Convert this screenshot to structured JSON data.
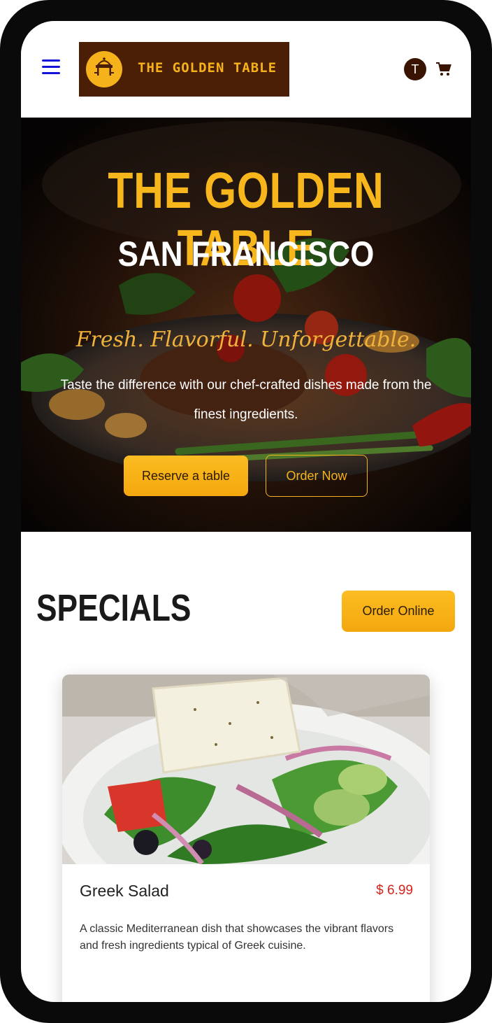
{
  "header": {
    "logo_text": "THE GOLDEN TABLE",
    "avatar_initial": "T",
    "menu_icon": "hamburger-menu-icon",
    "cart_icon": "shopping-cart-icon"
  },
  "hero": {
    "title": "THE GOLDEN TABLE",
    "city": "SAN FRANCISCO",
    "tagline": "Fresh. Flavorful. Unforgettable.",
    "description": "Taste the difference with our chef-crafted dishes made from the finest ingredients.",
    "reserve_label": "Reserve a table",
    "order_label": "Order Now"
  },
  "specials": {
    "title": "SPECIALS",
    "order_online_label": "Order Online",
    "items": [
      {
        "name": "Greek Salad",
        "price": "$ 6.99",
        "description": "A classic Mediterranean dish that showcases the vibrant flavors and fresh ingredients typical of Greek cuisine."
      }
    ]
  },
  "colors": {
    "brand_gold": "#f6b21a",
    "brand_brown": "#4a1f06",
    "price_red": "#d8231b",
    "menu_blue": "#1414d8"
  }
}
